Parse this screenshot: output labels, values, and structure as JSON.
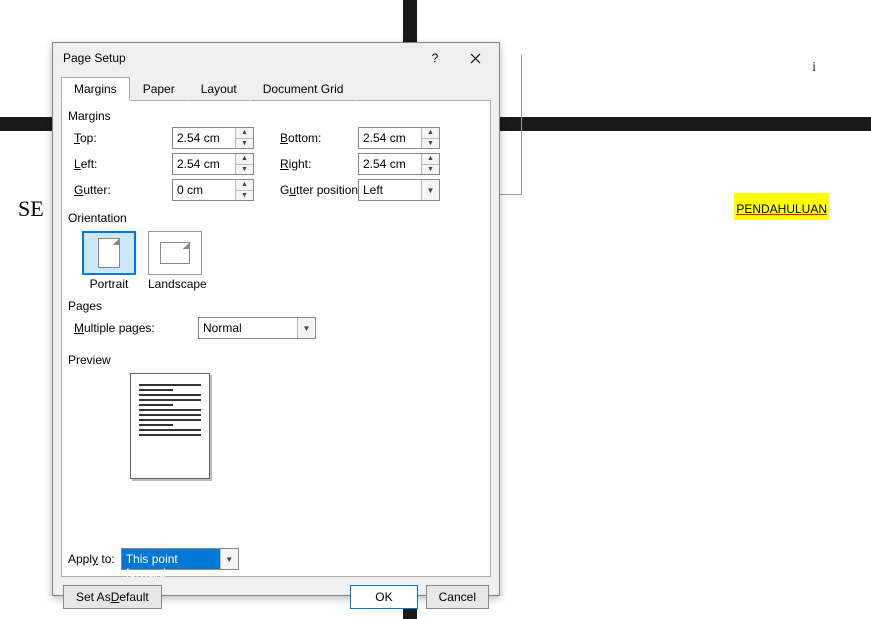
{
  "bg": {
    "se": "SE",
    "pendahuluan": "PENDAHULUAN",
    "i": "i"
  },
  "dialog": {
    "title": "Page Setup",
    "help": "?",
    "tabs": {
      "margins": "Margins",
      "paper": "Paper",
      "layout": "Layout",
      "docgrid": "Document Grid"
    },
    "margins": {
      "heading": "Margins",
      "top_label": "Top:",
      "top_value": "2.54 cm",
      "bottom_label": "Bottom:",
      "bottom_value": "2.54 cm",
      "left_label": "Left:",
      "left_value": "2.54 cm",
      "right_label": "Right:",
      "right_value": "2.54 cm",
      "gutter_label": "Gutter:",
      "gutter_value": "0 cm",
      "gutterpos_label": "Gutter position:",
      "gutterpos_value": "Left"
    },
    "orientation": {
      "heading": "Orientation",
      "portrait": "Portrait",
      "landscape": "Landscape"
    },
    "pages": {
      "heading": "Pages",
      "multiple_label": "Multiple pages:",
      "multiple_value": "Normal"
    },
    "preview": {
      "heading": "Preview"
    },
    "apply": {
      "label": "Apply to:",
      "value": "This point forward"
    },
    "buttons": {
      "setdefault": "Set As Default",
      "ok": "OK",
      "cancel": "Cancel"
    }
  }
}
